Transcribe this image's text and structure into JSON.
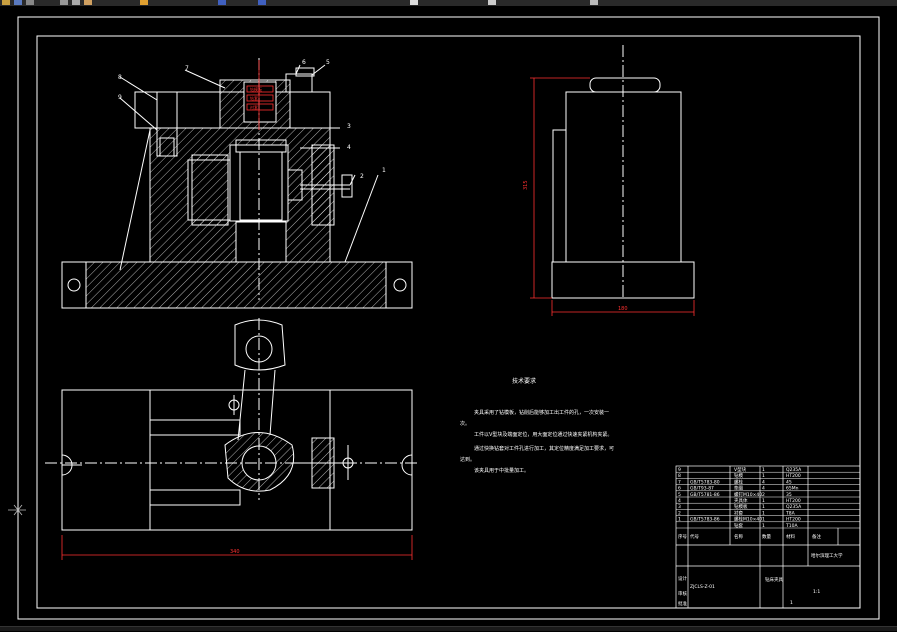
{
  "toolbar": {
    "icons": [
      "open-icon",
      "save-icon",
      "print-icon",
      "cut-icon",
      "copy-icon",
      "paste-icon",
      "match-icon",
      "undo-icon",
      "redo-icon",
      "pan-icon",
      "zoom-icon",
      "layer-icon"
    ]
  },
  "drawing": {
    "tech_req_title": "技术要求",
    "tech_req_lines": [
      "夹具采用了钻模板，钻削后能够加工出工件的孔，一次安装一",
      "次。",
      "工件以V型块及端面定位，用大面定位通过快速夹紧机构夹紧。",
      "通过快换钻套对工件孔进行加工，其定位精度满足加工要求，可",
      "达到。",
      "该夹具用于中批量加工。"
    ],
    "dim_bottom": "340",
    "dim_side_height": "315",
    "dim_side_width": "180",
    "callouts": [
      "8",
      "9",
      "7",
      "6",
      "5",
      "4",
      "3",
      "2",
      "1"
    ],
    "red_labels": [
      "钻模板",
      "钻套",
      "衬套"
    ]
  },
  "title_block": {
    "parts_rows": [
      [
        "9",
        "",
        "V型块",
        "1",
        "Q235A",
        ""
      ],
      [
        "8",
        "",
        "钻模",
        "1",
        "HT200",
        ""
      ],
      [
        "7",
        "GB/T5783-80",
        "螺栓",
        "4",
        "45",
        ""
      ],
      [
        "6",
        "GB/T93-87",
        "垫圈",
        "4",
        "65Mn",
        ""
      ],
      [
        "5",
        "GB/T5781-86",
        "螺钉M10×40",
        "2",
        "35",
        ""
      ],
      [
        "4",
        "",
        "夹具体",
        "1",
        "HT200",
        ""
      ],
      [
        "3",
        "",
        "钻模板",
        "1",
        "Q235A",
        ""
      ],
      [
        "2",
        "",
        "衬套",
        "1",
        "T8A",
        ""
      ],
      [
        "1",
        "GB/T5783-86",
        "螺栓M10×40",
        "1",
        "HT200",
        ""
      ],
      [
        "",
        "",
        "钻套",
        "1",
        "T10A",
        ""
      ]
    ],
    "header": [
      "序号",
      "代号",
      "名称",
      "数量",
      "材料",
      "备注"
    ],
    "school": "哈尔滨理工大学",
    "drawing_name": "钻床夹具",
    "scale": "1:1",
    "sheet": "1",
    "designer": "设计",
    "checker": "审核",
    "approved": "批准",
    "code": "ZJCLS-Z-01"
  }
}
